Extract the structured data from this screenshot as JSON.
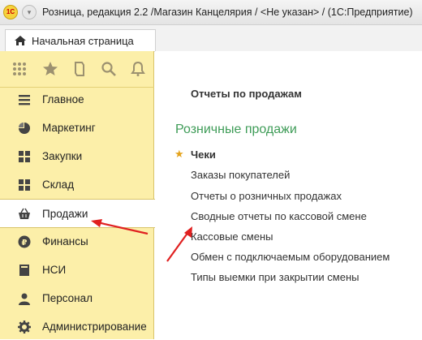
{
  "titlebar": {
    "logo_text": "1С",
    "text": "Розница, редакция 2.2 /Магазин Канцелярия / <Не указан> / (1С:Предприятие)"
  },
  "tabs": {
    "home_label": "Начальная страница"
  },
  "sidebar": {
    "items": [
      {
        "label": "Главное",
        "icon": "list-icon"
      },
      {
        "label": "Маркетинг",
        "icon": "pie-chart-icon"
      },
      {
        "label": "Закупки",
        "icon": "grid-icon"
      },
      {
        "label": "Склад",
        "icon": "grid-icon"
      },
      {
        "label": "Продажи",
        "icon": "basket-icon",
        "active": true
      },
      {
        "label": "Финансы",
        "icon": "ruble-icon"
      },
      {
        "label": "НСИ",
        "icon": "book-icon"
      },
      {
        "label": "Персонал",
        "icon": "person-icon"
      },
      {
        "label": "Администрирование",
        "icon": "gear-icon"
      }
    ]
  },
  "main": {
    "section_title": "Отчеты по продажам",
    "group_title": "Розничные продажи",
    "links": [
      "Чеки",
      "Заказы покупателей",
      "Отчеты о розничных продажах",
      "Сводные отчеты по кассовой смене",
      "Кассовые смены",
      "Обмен с подключаемым оборудованием",
      "Типы выемки при закрытии смены"
    ]
  },
  "colors": {
    "sidebar_bg": "#fcefa9",
    "group_title": "#3f9c58",
    "arrow": "#e02020",
    "star": "#e4a21b"
  }
}
